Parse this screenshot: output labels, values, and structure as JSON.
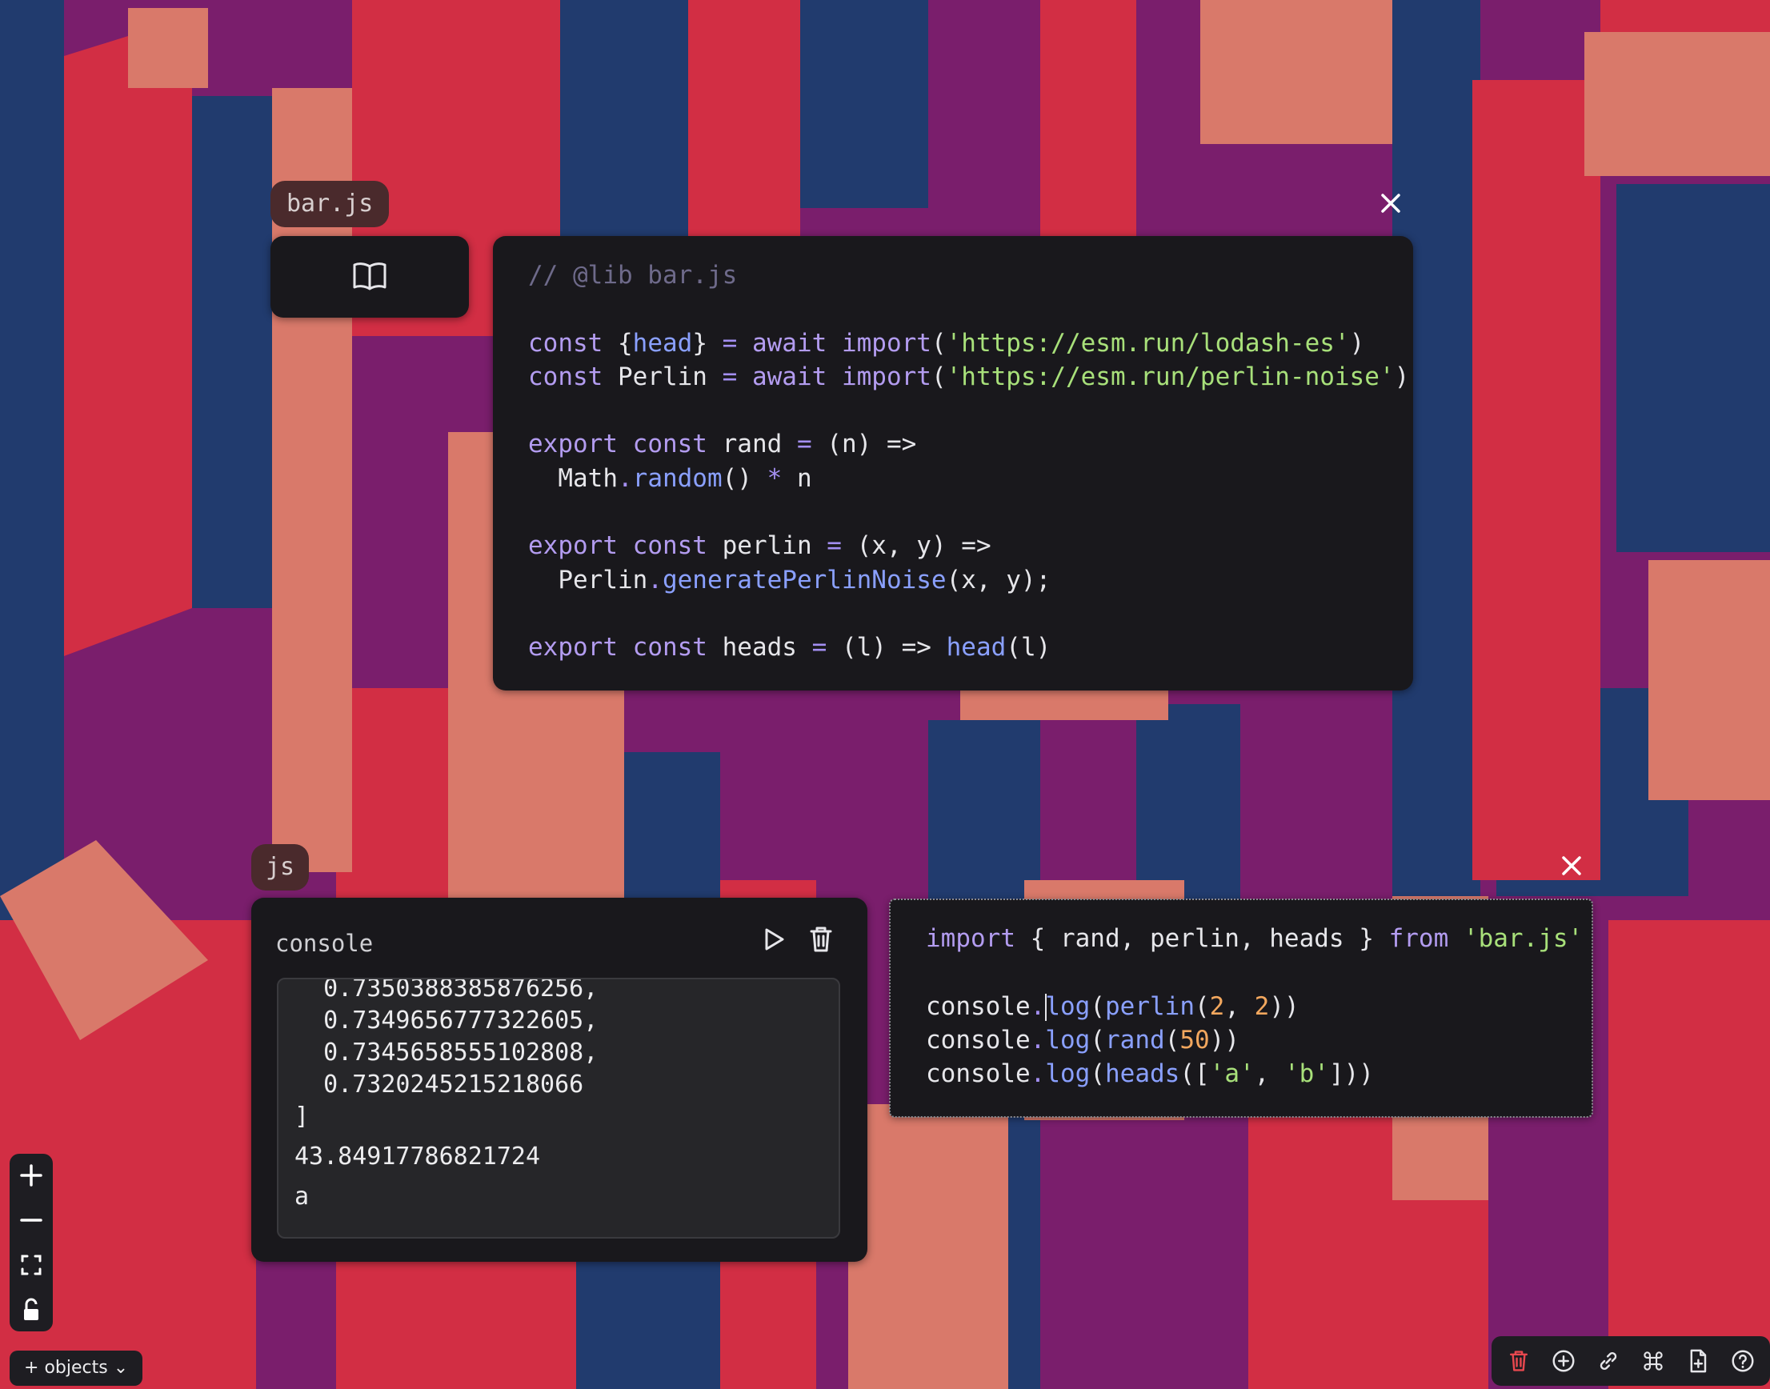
{
  "colors": {
    "magenta": "#7a1e6c",
    "navy": "#213b6e",
    "red": "#d22e44",
    "salmon": "#d9796a",
    "panel": "#19181c"
  },
  "lib_panel": {
    "tag_label": "bar.js",
    "sidebar_icon": "book-open-icon",
    "close_icon": "close-icon",
    "code_lines": [
      [
        {
          "t": "// @lib bar.js",
          "c": "cm"
        }
      ],
      [],
      [
        {
          "t": "const ",
          "c": "kw"
        },
        {
          "t": "{",
          "c": "tx"
        },
        {
          "t": "head",
          "c": "fn"
        },
        {
          "t": "} ",
          "c": "tx"
        },
        {
          "t": "=",
          "c": "op"
        },
        {
          "t": " ",
          "c": "tx"
        },
        {
          "t": "await",
          "c": "kw"
        },
        {
          "t": " ",
          "c": "tx"
        },
        {
          "t": "import",
          "c": "kw"
        },
        {
          "t": "(",
          "c": "tx"
        },
        {
          "t": "'https://esm.run/lodash-es'",
          "c": "st"
        },
        {
          "t": ")",
          "c": "tx"
        }
      ],
      [
        {
          "t": "const ",
          "c": "kw"
        },
        {
          "t": "Perlin ",
          "c": "tx"
        },
        {
          "t": "=",
          "c": "op"
        },
        {
          "t": " ",
          "c": "tx"
        },
        {
          "t": "await",
          "c": "kw"
        },
        {
          "t": " ",
          "c": "tx"
        },
        {
          "t": "import",
          "c": "kw"
        },
        {
          "t": "(",
          "c": "tx"
        },
        {
          "t": "'https://esm.run/perlin-noise'",
          "c": "st"
        },
        {
          "t": ")",
          "c": "tx"
        }
      ],
      [],
      [
        {
          "t": "export",
          "c": "kw"
        },
        {
          "t": " ",
          "c": "tx"
        },
        {
          "t": "const",
          "c": "kw"
        },
        {
          "t": " rand ",
          "c": "tx"
        },
        {
          "t": "=",
          "c": "op"
        },
        {
          "t": " (n) ",
          "c": "tx"
        },
        {
          "t": "=>",
          "c": "tx"
        }
      ],
      [
        {
          "t": "  Math",
          "c": "tx"
        },
        {
          "t": ".",
          "c": "op"
        },
        {
          "t": "random",
          "c": "fn"
        },
        {
          "t": "() ",
          "c": "tx"
        },
        {
          "t": "*",
          "c": "op"
        },
        {
          "t": " n",
          "c": "tx"
        }
      ],
      [],
      [
        {
          "t": "export",
          "c": "kw"
        },
        {
          "t": " ",
          "c": "tx"
        },
        {
          "t": "const",
          "c": "kw"
        },
        {
          "t": " perlin ",
          "c": "tx"
        },
        {
          "t": "=",
          "c": "op"
        },
        {
          "t": " (x, y) ",
          "c": "tx"
        },
        {
          "t": "=>",
          "c": "tx"
        }
      ],
      [
        {
          "t": "  Perlin",
          "c": "tx"
        },
        {
          "t": ".",
          "c": "op"
        },
        {
          "t": "generatePerlinNoise",
          "c": "fn"
        },
        {
          "t": "(x, y);",
          "c": "tx"
        }
      ],
      [],
      [
        {
          "t": "export",
          "c": "kw"
        },
        {
          "t": " ",
          "c": "tx"
        },
        {
          "t": "const",
          "c": "kw"
        },
        {
          "t": " heads ",
          "c": "tx"
        },
        {
          "t": "=",
          "c": "op"
        },
        {
          "t": " (l) ",
          "c": "tx"
        },
        {
          "t": "=>",
          "c": "tx"
        },
        {
          "t": " ",
          "c": "tx"
        },
        {
          "t": "head",
          "c": "fn"
        },
        {
          "t": "(l)",
          "c": "tx"
        }
      ]
    ]
  },
  "js_panel": {
    "tag_label": "js",
    "console": {
      "title": "console",
      "run_icon": "play-icon",
      "clear_icon": "trash-icon",
      "output_lines": [
        "  0.7350388385876256,",
        "  0.7349656777322605,",
        "  0.7345658555102808,",
        "  0.7320245215218066",
        "]",
        "43.84917786821724",
        "a"
      ]
    },
    "close_icon": "close-icon",
    "code_lines": [
      [
        {
          "t": "import",
          "c": "kw"
        },
        {
          "t": " { rand, perlin, heads } ",
          "c": "tx"
        },
        {
          "t": "from",
          "c": "kw"
        },
        {
          "t": " ",
          "c": "tx"
        },
        {
          "t": "'bar.js'",
          "c": "st"
        }
      ],
      [],
      [
        {
          "t": "console",
          "c": "tx"
        },
        {
          "t": ".",
          "c": "op"
        },
        {
          "t": "|",
          "c": "cursor"
        },
        {
          "t": "log",
          "c": "fn"
        },
        {
          "t": "(",
          "c": "tx"
        },
        {
          "t": "perlin",
          "c": "fn"
        },
        {
          "t": "(",
          "c": "tx"
        },
        {
          "t": "2",
          "c": "nm"
        },
        {
          "t": ", ",
          "c": "tx"
        },
        {
          "t": "2",
          "c": "nm"
        },
        {
          "t": "))",
          "c": "tx"
        }
      ],
      [
        {
          "t": "console",
          "c": "tx"
        },
        {
          "t": ".",
          "c": "op"
        },
        {
          "t": "log",
          "c": "fn"
        },
        {
          "t": "(",
          "c": "tx"
        },
        {
          "t": "rand",
          "c": "fn"
        },
        {
          "t": "(",
          "c": "tx"
        },
        {
          "t": "50",
          "c": "nm"
        },
        {
          "t": "))",
          "c": "tx"
        }
      ],
      [
        {
          "t": "console",
          "c": "tx"
        },
        {
          "t": ".",
          "c": "op"
        },
        {
          "t": "log",
          "c": "fn"
        },
        {
          "t": "(",
          "c": "tx"
        },
        {
          "t": "heads",
          "c": "fn"
        },
        {
          "t": "([",
          "c": "tx"
        },
        {
          "t": "'a'",
          "c": "st"
        },
        {
          "t": ", ",
          "c": "tx"
        },
        {
          "t": "'b'",
          "c": "st"
        },
        {
          "t": "]))",
          "c": "tx"
        }
      ]
    ]
  },
  "zoom_controls": {
    "zoom_in_icon": "plus-icon",
    "zoom_out_icon": "minus-icon",
    "fit_icon": "fit-screen-icon",
    "lock_icon": "lock-icon"
  },
  "objects_menu": {
    "label": "objects"
  },
  "toolbar": {
    "icons": [
      "trash-icon",
      "add-circle-icon",
      "link-icon",
      "command-icon",
      "file-icon",
      "help-icon"
    ]
  }
}
